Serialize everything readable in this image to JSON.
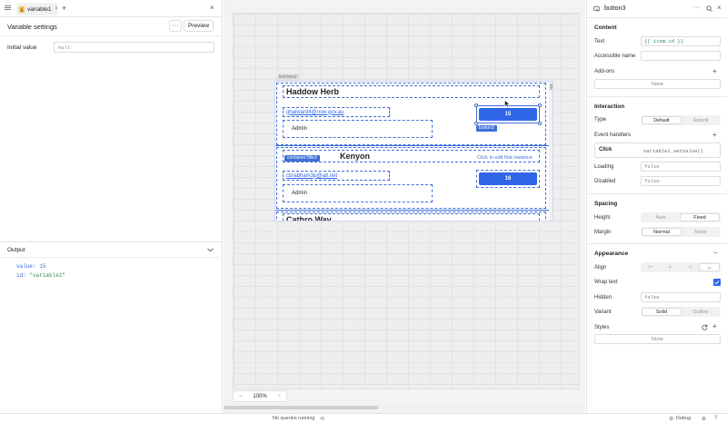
{
  "left": {
    "tab_label": "variable1",
    "panel_title": "Variable settings",
    "preview_label": "Preview",
    "initial_value_label": "Initial value",
    "initial_value_placeholder": "null",
    "output_title": "Output",
    "output_lines": [
      {
        "key": "value:",
        "val": "15"
      },
      {
        "key": "id:",
        "val": "\"variable1\""
      }
    ]
  },
  "canvas": {
    "listview_tag": "listView2",
    "items": [
      {
        "name": "Haddow Herb",
        "email": "ghalward4@nsw.gov.au",
        "role": "Admin",
        "button": "15"
      },
      {
        "name": "Kenyon",
        "email": "cbrabham3p@a8.net",
        "role": "Admin",
        "button": "16"
      },
      {
        "name": "Cathro Wav"
      }
    ],
    "button_tag": "button3",
    "container_tag": "containerTitle3",
    "edit_hint": "Click to edit first instance",
    "zoom": "100%"
  },
  "right": {
    "component_name": "button3",
    "content_title": "Content",
    "text_label": "Text",
    "text_value": "{{ item.id }}",
    "accessible_label": "Accessible name",
    "addons_label": "Add-ons",
    "none": "None",
    "interaction_title": "Interaction",
    "type_label": "Type",
    "type_options": [
      "Default",
      "Submit"
    ],
    "event_handlers_label": "Event handlers",
    "event_name": "Click",
    "event_action": "variable1.setValue()",
    "loading_label": "Loading",
    "loading_value": "false",
    "disabled_label": "Disabled",
    "disabled_value": "false",
    "spacing_title": "Spacing",
    "height_label": "Height",
    "height_options": [
      "Auto",
      "Fixed"
    ],
    "margin_label": "Margin",
    "margin_options": [
      "Normal",
      "None"
    ],
    "appearance_title": "Appearance",
    "align_label": "Align",
    "wrap_label": "Wrap text",
    "hidden_label": "Hidden",
    "hidden_value": "false",
    "variant_label": "Variant",
    "variant_options": [
      "Solid",
      "Outline"
    ],
    "styles_label": "Styles"
  },
  "status": {
    "queries": "No queries running",
    "debug": "Debug"
  },
  "colors": {
    "accent": "#2f66e8",
    "outline": "#3f6fd6"
  }
}
